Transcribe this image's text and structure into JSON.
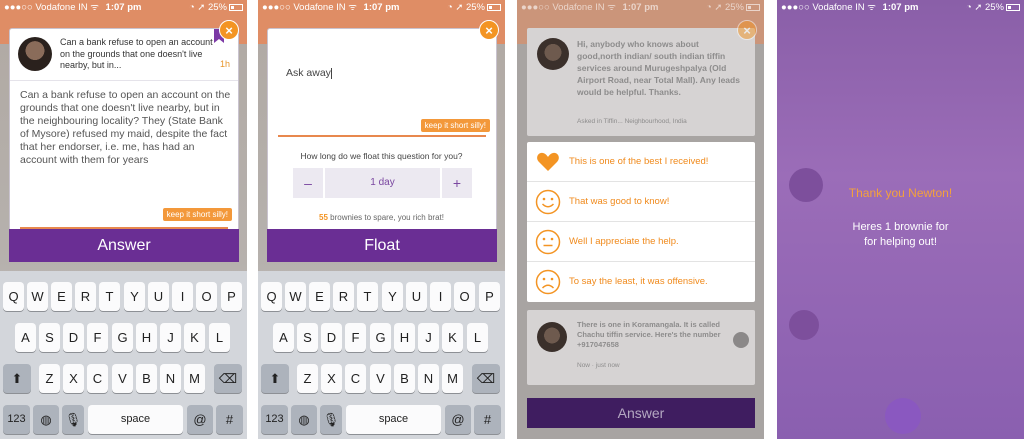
{
  "status": {
    "carrier": "Vodafone IN",
    "time": "1:07 pm",
    "battery": "25%"
  },
  "screen1": {
    "close_glyph": "×",
    "question_summary": "Can a bank refuse to open an account on the grounds that one doesn't live nearby, but in...",
    "question_age": "1h",
    "question_full": "Can a bank refuse to open an account on the grounds that one doesn't live nearby, but in the neighbouring locality? They (State Bank of Mysore) refused my maid, despite the fact that her endorser, i.e. me, has had an account with them for years",
    "tag": "keep it short silly!",
    "action": "Answer"
  },
  "screen2": {
    "close_glyph": "×",
    "input_value": "Ask away",
    "tag": "keep it short silly!",
    "duration_label": "How long do we float this question for you?",
    "minus": "–",
    "duration_value": "1 day",
    "plus": "+",
    "brownie_count": "55",
    "brownie_text": " brownies to spare, you rich brat!",
    "action": "Float"
  },
  "screen3": {
    "close_glyph": "×",
    "bg_top_text": "Hi, anybody who knows about good,north indian/ south indian tiffin services around Murugeshpalya (Old Airport Road, near Total Mall). Any leads would be helpful. Thanks.",
    "bg_top_meta": "Asked in Tiffin... Neighbourhood, India",
    "bg_bottom_text": "There is one in Koramangala. It is called Chachu tiffin service. Here's the number +917047658",
    "bg_bottom_meta": "Now · just now",
    "ratings": [
      {
        "icon": "heart-icon",
        "label": "This is one of the best I received!"
      },
      {
        "icon": "smile-icon",
        "label": "That was good to know!"
      },
      {
        "icon": "neutral-face-icon",
        "label": "Well I appreciate the help."
      },
      {
        "icon": "frown-icon",
        "label": "To say the least, it was offensive."
      }
    ],
    "action": "Answer"
  },
  "screen4": {
    "title": "Thank you Newton!",
    "line1": "Heres 1 brownie for",
    "line2": "for helping out!"
  },
  "keyboard": {
    "row1": [
      "Q",
      "W",
      "E",
      "R",
      "T",
      "Y",
      "U",
      "I",
      "O",
      "P"
    ],
    "row2": [
      "A",
      "S",
      "D",
      "F",
      "G",
      "H",
      "J",
      "K",
      "L"
    ],
    "row3": [
      "Z",
      "X",
      "C",
      "V",
      "B",
      "N",
      "M"
    ],
    "numbers": "123",
    "space": "space",
    "at": "@",
    "hash": "#"
  },
  "colors": {
    "accent": "#f39423",
    "brand_purple": "#6a2e94"
  }
}
